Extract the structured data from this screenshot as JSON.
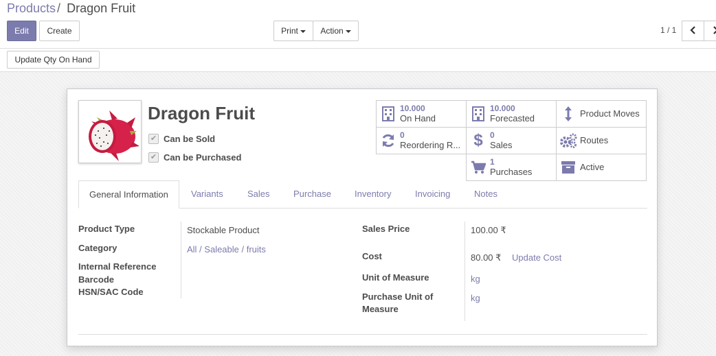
{
  "breadcrumb": {
    "parent": "Products",
    "separator": "/",
    "current": "Dragon Fruit"
  },
  "toolbar": {
    "edit_label": "Edit",
    "create_label": "Create",
    "print_label": "Print",
    "action_label": "Action"
  },
  "pager": {
    "value": "1 / 1",
    "prev_icon": "chevron-left-icon",
    "next_icon": "chevron-right-icon"
  },
  "statusbar": {
    "update_qty_label": "Update Qty On Hand"
  },
  "product": {
    "name": "Dragon Fruit",
    "can_be_sold_label": "Can be Sold",
    "can_be_purchased_label": "Can be Purchased",
    "image_icon": "dragon-fruit-image"
  },
  "stats": {
    "on_hand": {
      "value": "10.000",
      "label": "On Hand",
      "icon": "building-icon"
    },
    "forecasted": {
      "value": "10.000",
      "label": "Forecasted",
      "icon": "building-icon"
    },
    "product_moves": {
      "label": "Product Moves",
      "icon": "arrows-vertical-icon"
    },
    "reordering": {
      "value": "0",
      "label": "Reordering R...",
      "icon": "refresh-icon"
    },
    "sales": {
      "value": "0",
      "label": "Sales",
      "icon": "dollar-icon"
    },
    "routes": {
      "label": "Routes",
      "icon": "cogs-icon"
    },
    "purchases": {
      "value": "1",
      "label": "Purchases",
      "icon": "shopping-cart-icon"
    },
    "active": {
      "label": "Active",
      "icon": "archive-icon"
    }
  },
  "tabs": [
    "General Information",
    "Variants",
    "Sales",
    "Purchase",
    "Inventory",
    "Invoicing",
    "Notes"
  ],
  "general": {
    "product_type_label": "Product Type",
    "product_type_value": "Stockable Product",
    "category_label": "Category",
    "category_value": "All / Saleable / fruits",
    "internal_ref_label": "Internal Reference",
    "barcode_label": "Barcode",
    "hsn_label": "HSN/SAC Code",
    "sales_price_label": "Sales Price",
    "sales_price_value": "100.00 ₹",
    "cost_label": "Cost",
    "cost_value": "80.00 ₹",
    "update_cost_label": "Update Cost",
    "uom_label": "Unit of Measure",
    "uom_value": "kg",
    "purchase_uom_label_1": "Purchase Unit of",
    "purchase_uom_label_2": "Measure",
    "purchase_uom_value": "kg"
  },
  "colors": {
    "brand": "#7c7bad",
    "text": "#4c4c4c",
    "border": "#cccccc",
    "fruit": "#d6224a"
  }
}
